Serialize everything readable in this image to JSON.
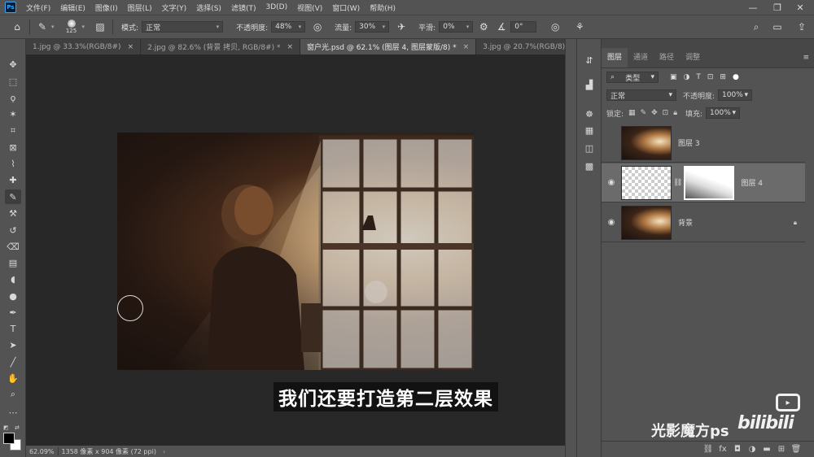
{
  "app": {
    "logo": "Ps"
  },
  "menu": [
    "文件(F)",
    "编辑(E)",
    "图像(I)",
    "图层(L)",
    "文字(Y)",
    "选择(S)",
    "滤镜(T)",
    "3D(D)",
    "视图(V)",
    "窗口(W)",
    "帮助(H)"
  ],
  "window_controls": {
    "minimize": "—",
    "restore": "❐",
    "close": "✕"
  },
  "options": {
    "brush_size": "125",
    "mode_label": "模式:",
    "mode_value": "正常",
    "opacity_label": "不透明度:",
    "opacity_value": "48%",
    "flow_label": "流量:",
    "flow_value": "30%",
    "smooth_label": "平滑:",
    "smooth_value": "0%",
    "angle_value": "0°"
  },
  "tabs": [
    {
      "label": "1.jpg @ 33.3%(RGB/8#)",
      "close": "×"
    },
    {
      "label": "2.jpg @ 82.6% (背景 拷贝, RGB/8#) *",
      "close": "×"
    },
    {
      "label": "窗户光.psd @ 62.1% (图层 4, 图层蒙版/8) *",
      "close": "×"
    },
    {
      "label": "3.jpg @ 20.7%(RGB/8)",
      "close": "×"
    }
  ],
  "status": {
    "zoom": "62.09%",
    "doc": "1358 像素 x 904 像素 (72 ppi)"
  },
  "panel": {
    "tabs": [
      "图层",
      "通道",
      "路径",
      "调整"
    ],
    "filter_kind": "类型",
    "blend_mode": "正常",
    "opacity_label": "不透明度:",
    "opacity_value": "100%",
    "lock_label": "锁定:",
    "fill_label": "填充:",
    "fill_value": "100%",
    "layers": [
      {
        "name": "图层 3",
        "visible": false
      },
      {
        "name": "图层 4",
        "visible": true
      },
      {
        "name": "背景",
        "visible": true
      }
    ]
  },
  "subtitle": "我们还要打造第二层效果",
  "watermark": "光影魔方ps",
  "bili_logo": "bilibili",
  "icons": {
    "home": "home-icon",
    "brush": "brush-icon",
    "eye": "eye-icon",
    "lock": "lock-icon",
    "search": "search-icon"
  },
  "colors": {
    "ui_bg": "#535353",
    "canvas_bg": "#282828",
    "panel_dark": "#3a3a3a",
    "ps_blue": "#31a8ff",
    "selected_layer": "#6b6b6b"
  }
}
